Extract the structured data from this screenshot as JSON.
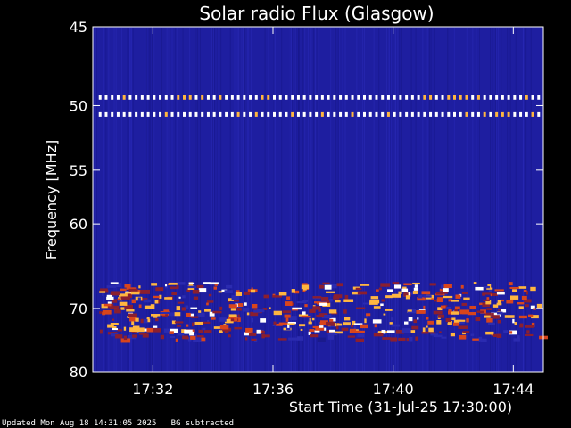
{
  "chart_data": {
    "type": "heatmap",
    "title": "Solar radio Flux (Glasgow)",
    "xlabel": "Start Time (31-Jul-25 17:30:00)",
    "ylabel": "Frequency [MHz]",
    "x_ticks": [
      "17:32",
      "17:36",
      "17:40",
      "17:44"
    ],
    "x_tick_minutes": [
      2,
      6,
      10,
      14
    ],
    "x_range_minutes": [
      0,
      15
    ],
    "y_ticks": [
      45,
      50,
      55,
      60,
      70,
      80
    ],
    "y_range_mhz": [
      45,
      80
    ],
    "y_scale": "reciprocal",
    "colormap": [
      "#1a1a8c",
      "#2b2bb0",
      "#8b1f2f",
      "#d8451c",
      "#ffb640",
      "#ffffff"
    ],
    "background_color": "#1e1ea0",
    "features": [
      {
        "name": "narrowband-interference",
        "freq_mhz": 49.4,
        "x_start": 0.2,
        "x_end": 14.8,
        "intensity": 0.95
      },
      {
        "name": "narrowband-interference",
        "freq_mhz": 50.6,
        "x_start": 0.2,
        "x_end": 14.8,
        "intensity": 0.9
      },
      {
        "name": "emission-band",
        "freq_min_mhz": 66.5,
        "freq_max_mhz": 73.5,
        "x_start": 0.2,
        "x_end": 14.8,
        "intensity": 0.85
      },
      {
        "name": "weak-band",
        "freq_min_mhz": 73.5,
        "freq_max_mhz": 74.5,
        "x_start": 0.3,
        "x_end": 14.9,
        "intensity": 0.5
      }
    ]
  },
  "footer": {
    "updated": "Updated Mon Aug 18 14:31:05 2025",
    "note": "BG subtracted"
  }
}
